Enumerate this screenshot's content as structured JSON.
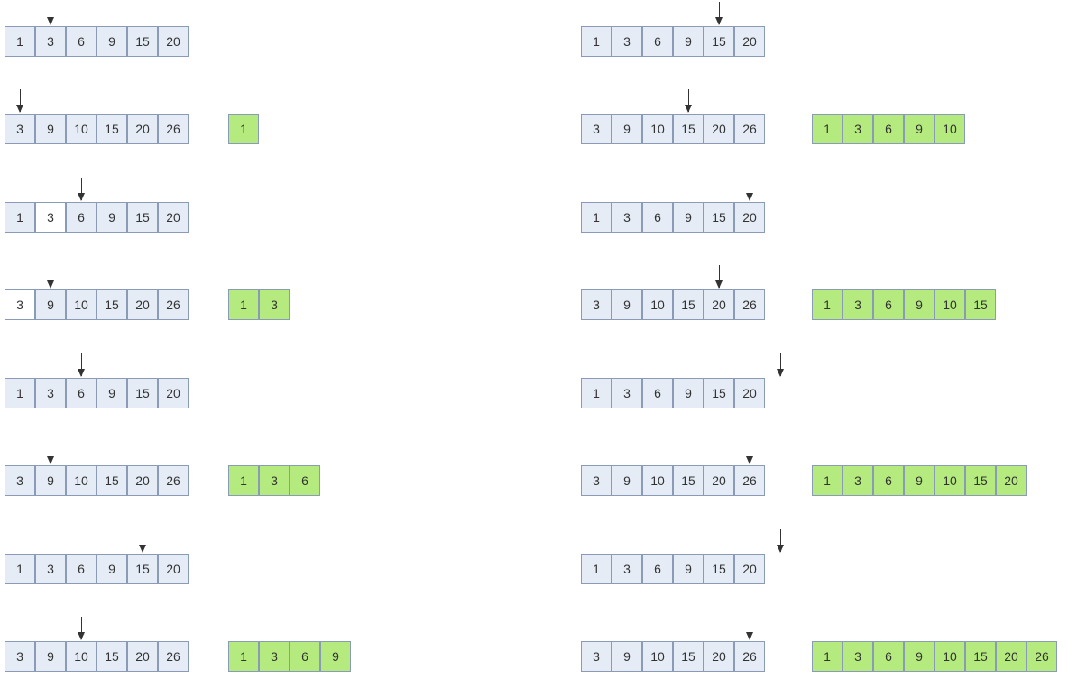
{
  "array1": [
    "1",
    "3",
    "6",
    "9",
    "15",
    "20"
  ],
  "array2": [
    "3",
    "9",
    "10",
    "15",
    "20",
    "26"
  ],
  "steps": [
    {
      "col": "left",
      "row": 0,
      "arrow1_idx": 1,
      "arrow2_idx": 0,
      "a1_white": [],
      "a2_white": [],
      "result": [
        "1"
      ]
    },
    {
      "col": "left",
      "row": 1,
      "arrow1_idx": 2,
      "arrow2_idx": 1,
      "a1_white": [
        1
      ],
      "a2_white": [
        0
      ],
      "result": [
        "1",
        "3"
      ]
    },
    {
      "col": "left",
      "row": 2,
      "arrow1_idx": 2,
      "arrow2_idx": 1,
      "a1_white": [],
      "a2_white": [],
      "result": [
        "1",
        "3",
        "6"
      ]
    },
    {
      "col": "left",
      "row": 3,
      "arrow1_idx": 4,
      "arrow2_idx": 2,
      "a1_white": [],
      "a2_white": [],
      "result": [
        "1",
        "3",
        "6",
        "9"
      ]
    },
    {
      "col": "right",
      "row": 0,
      "arrow1_idx": 4,
      "arrow2_idx": 3,
      "a1_white": [],
      "a2_white": [],
      "result": [
        "1",
        "3",
        "6",
        "9",
        "10"
      ]
    },
    {
      "col": "right",
      "row": 1,
      "arrow1_idx": 5,
      "arrow2_idx": 4,
      "a1_white": [],
      "a2_white": [],
      "result": [
        "1",
        "3",
        "6",
        "9",
        "10",
        "15"
      ]
    },
    {
      "col": "right",
      "row": 2,
      "arrow1_idx": 6,
      "arrow2_idx": 5,
      "a1_white": [],
      "a2_white": [],
      "result": [
        "1",
        "3",
        "6",
        "9",
        "10",
        "15",
        "20"
      ]
    },
    {
      "col": "right",
      "row": 3,
      "arrow1_idx": 6,
      "arrow2_idx": 5,
      "a1_white": [],
      "a2_white": [],
      "result": [
        "1",
        "3",
        "6",
        "9",
        "10",
        "15",
        "20",
        "26"
      ]
    }
  ]
}
